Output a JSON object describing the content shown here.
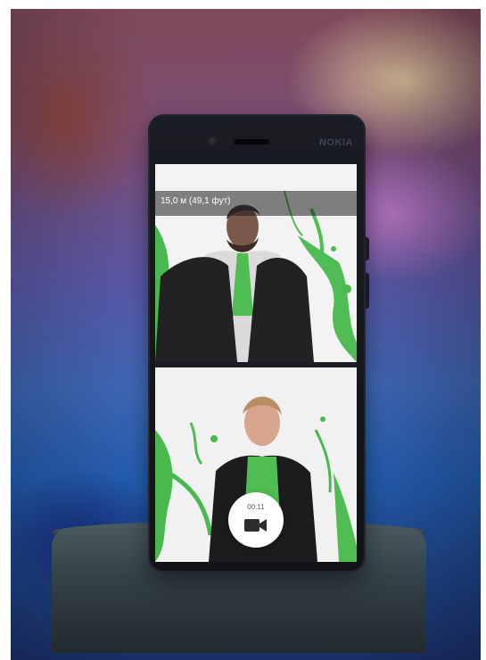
{
  "device": {
    "brand": "NOKIA"
  },
  "camera_app": {
    "distance_label": "15,0 м (49,1 фут)",
    "record_timer": "00:11"
  },
  "icons": {
    "record": "videocam-icon"
  },
  "colors": {
    "splash_green": "#49b84d",
    "phone_body": "#111318",
    "screen_bg": "#f4f4f4"
  }
}
